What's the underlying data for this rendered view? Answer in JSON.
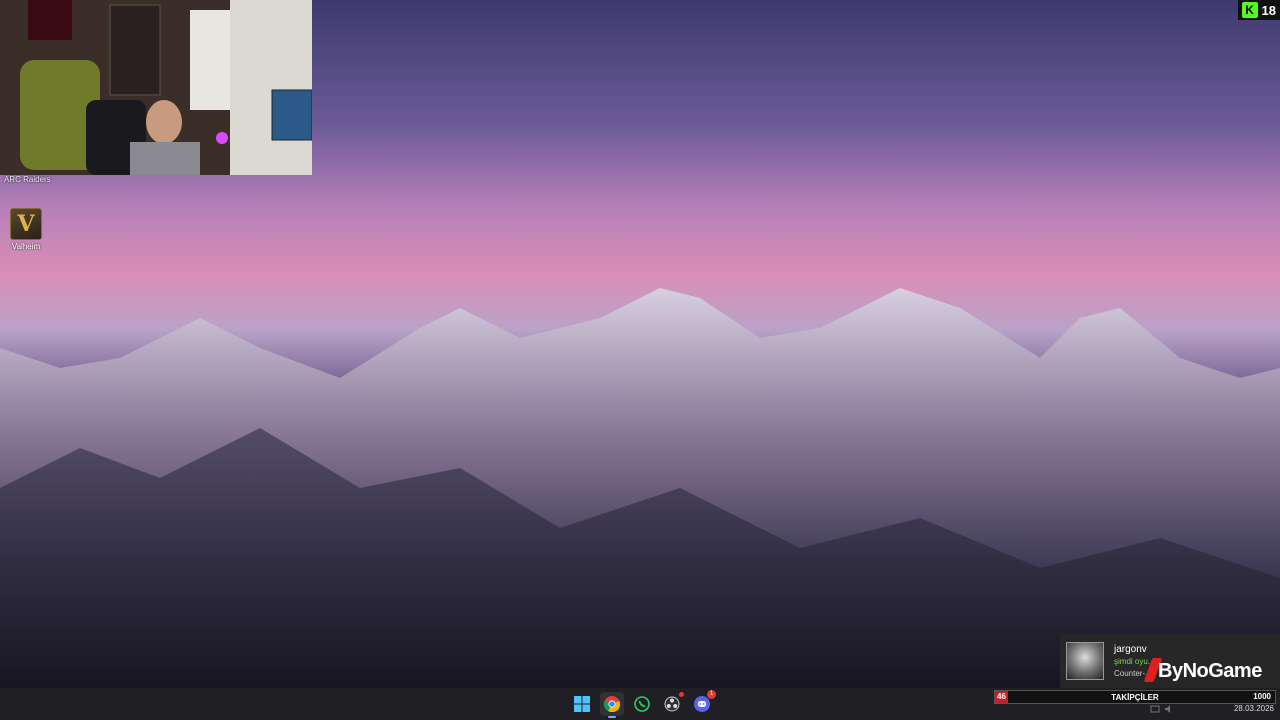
{
  "webcam": {
    "label": "ARC Raiders"
  },
  "desktop_icons": [
    {
      "label": "Valheim",
      "icon": "valheim-icon",
      "glyph": "V"
    }
  ],
  "kick": {
    "letter": "K",
    "viewers": "18",
    "icon": "kick-logo-icon"
  },
  "notification": {
    "username": "jargonv",
    "status": "şimdi oyu...",
    "game": "Counter-...",
    "brand": "ByNoGame"
  },
  "taskbar": {
    "apps": [
      {
        "name": "windows-start-icon",
        "active": false
      },
      {
        "name": "chrome-icon",
        "active": true
      },
      {
        "name": "whatsapp-icon",
        "active": false
      },
      {
        "name": "obs-icon",
        "active": false,
        "badge": ""
      },
      {
        "name": "discord-icon",
        "active": false,
        "badge": "1"
      }
    ]
  },
  "followers": {
    "current": "46",
    "label": "TAKİPÇİLER",
    "goal": "1000",
    "progress_fraction": 0.046
  },
  "tray": {
    "date": "28.03.2026"
  },
  "colors": {
    "accent": "#7aa7ff",
    "kick_green": "#53fc18",
    "follow_red": "#c81e28"
  }
}
